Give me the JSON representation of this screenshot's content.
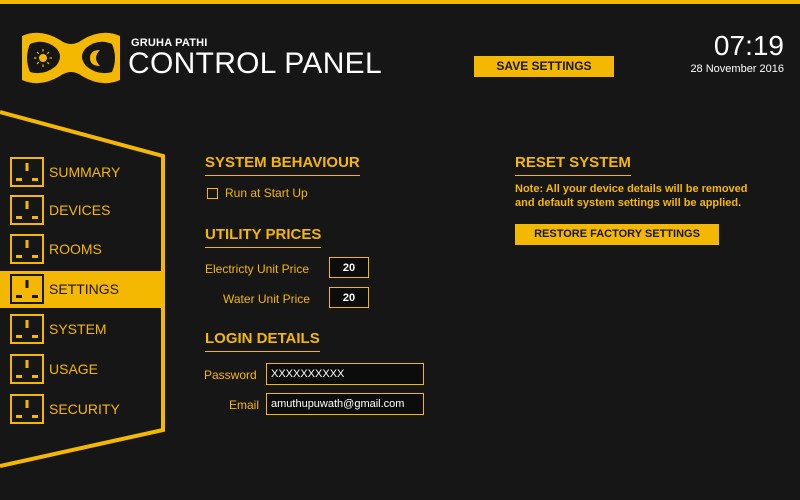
{
  "header": {
    "brand_subtitle": "GRUHA PATHI",
    "brand_title": "CONTROL PANEL",
    "save_label": "SAVE SETTINGS",
    "time": "07:19",
    "date": "28 November 2016"
  },
  "sidebar": {
    "active": "SETTINGS",
    "items": [
      {
        "label": "SUMMARY"
      },
      {
        "label": "DEVICES"
      },
      {
        "label": "ROOMS"
      },
      {
        "label": "SETTINGS"
      },
      {
        "label": "SYSTEM"
      },
      {
        "label": "USAGE"
      },
      {
        "label": "SECURITY"
      }
    ]
  },
  "system_behaviour": {
    "heading": "SYSTEM BEHAVIOUR",
    "run_at_startup_label": "Run at Start Up",
    "run_at_startup_checked": false
  },
  "utility_prices": {
    "heading": "UTILITY PRICES",
    "electricity_label": "Electricty Unit Price",
    "electricity_value": "20",
    "water_label": "Water Unit Price",
    "water_value": "20"
  },
  "login_details": {
    "heading": "LOGIN DETAILS",
    "password_label": "Password",
    "password_value": "XXXXXXXXXX",
    "email_label": "Email",
    "email_value": "amuthupuwath@gmail.com"
  },
  "reset_system": {
    "heading": "RESET SYSTEM",
    "note_line1": "Note: All your device details will be removed",
    "note_line2": "and default system settings will be applied.",
    "restore_label": "RESTORE FACTORY SETTINGS"
  },
  "colors": {
    "accent": "#f5b800",
    "background": "#161616",
    "text_light": "#ffffff"
  }
}
